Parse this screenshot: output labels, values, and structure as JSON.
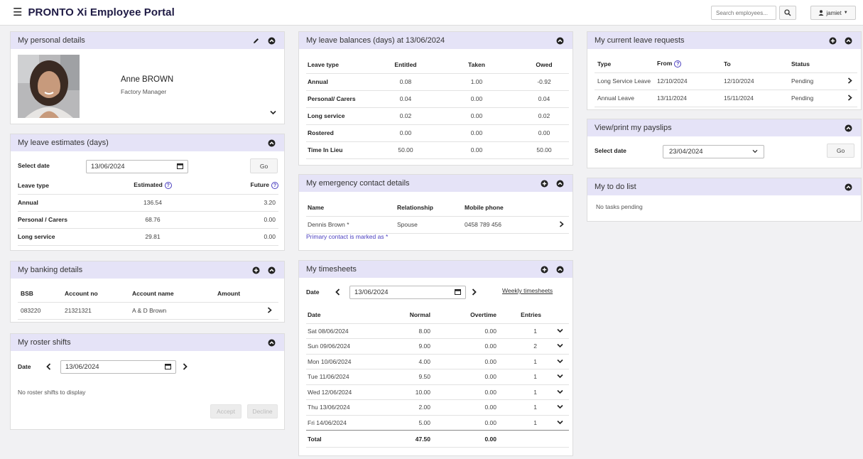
{
  "header": {
    "brand": "PRONTO Xi Employee Portal",
    "search_placeholder": "Search employees...",
    "user": "jamiet"
  },
  "personal": {
    "title": "My personal details",
    "name": "Anne BROWN",
    "role": "Factory Manager"
  },
  "estimates": {
    "title": "My leave estimates (days)",
    "select_label": "Select date",
    "date": "13/06/2024",
    "go": "Go",
    "headers": [
      "Leave type",
      "Estimated",
      "Future"
    ],
    "rows": [
      [
        "Annual",
        "136.54",
        "3.20"
      ],
      [
        "Personal / Carers",
        "68.76",
        "0.00"
      ],
      [
        "Long service",
        "29.81",
        "0.00"
      ]
    ]
  },
  "banking": {
    "title": "My banking details",
    "headers": [
      "BSB",
      "Account no",
      "Account name",
      "Amount"
    ],
    "rows": [
      [
        "083220",
        "21321321",
        "A & D Brown",
        ""
      ]
    ]
  },
  "roster": {
    "title": "My roster shifts",
    "date_label": "Date",
    "date": "13/06/2024",
    "empty": "No roster shifts to display",
    "accept": "Accept",
    "decline": "Decline"
  },
  "balances": {
    "title": "My leave balances (days) at 13/06/2024",
    "headers": [
      "Leave type",
      "Entitled",
      "Taken",
      "Owed"
    ],
    "rows": [
      [
        "Annual",
        "0.08",
        "1.00",
        "-0.92"
      ],
      [
        "Personal/ Carers",
        "0.04",
        "0.00",
        "0.04"
      ],
      [
        "Long service",
        "0.02",
        "0.00",
        "0.02"
      ],
      [
        "Rostered",
        "0.00",
        "0.00",
        "0.00"
      ],
      [
        "Time In Lieu",
        "50.00",
        "0.00",
        "50.00"
      ]
    ]
  },
  "emergency": {
    "title": "My emergency contact details",
    "headers": [
      "Name",
      "Relationship",
      "Mobile phone"
    ],
    "rows": [
      [
        "Dennis Brown *",
        "Spouse",
        "0458 789 456"
      ]
    ],
    "note": "Primary contact is marked as *"
  },
  "timesheets": {
    "title": "My timesheets",
    "date_label": "Date",
    "date": "13/06/2024",
    "weekly_link": "Weekly timesheets",
    "headers": [
      "Date",
      "Normal",
      "Overtime",
      "Entries"
    ],
    "rows": [
      [
        "Sat 08/06/2024",
        "8.00",
        "0.00",
        "1"
      ],
      [
        "Sun 09/06/2024",
        "9.00",
        "0.00",
        "2"
      ],
      [
        "Mon 10/06/2024",
        "4.00",
        "0.00",
        "1"
      ],
      [
        "Tue 11/06/2024",
        "9.50",
        "0.00",
        "1"
      ],
      [
        "Wed 12/06/2024",
        "10.00",
        "0.00",
        "1"
      ],
      [
        "Thu 13/06/2024",
        "2.00",
        "0.00",
        "1"
      ],
      [
        "Fri 14/06/2024",
        "5.00",
        "0.00",
        "1"
      ]
    ],
    "total_label": "Total",
    "total_normal": "47.50",
    "total_overtime": "0.00"
  },
  "requests": {
    "title": "My current leave requests",
    "headers": [
      "Type",
      "From",
      "To",
      "Status"
    ],
    "rows": [
      [
        "Long Service Leave",
        "12/10/2024",
        "12/10/2024",
        "Pending"
      ],
      [
        "Annual Leave",
        "13/11/2024",
        "15/11/2024",
        "Pending"
      ]
    ]
  },
  "payslips": {
    "title": "View/print my payslips",
    "select_label": "Select date",
    "date": "23/04/2024",
    "go": "Go"
  },
  "todo": {
    "title": "My to do list",
    "empty": "No tasks pending"
  },
  "colors": {
    "panel_header": "#e5e3f7",
    "accent": "#4a3fc0",
    "brand_text": "#1e1a44"
  }
}
